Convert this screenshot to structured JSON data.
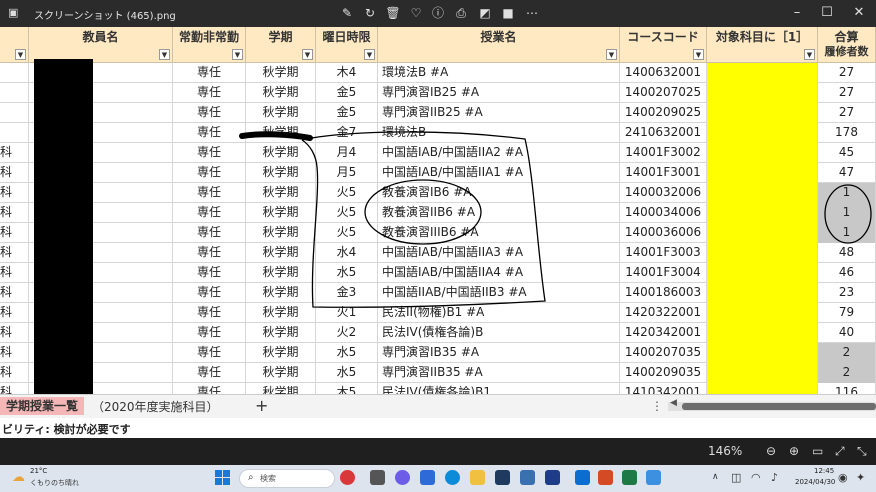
{
  "titlebar": {
    "filename": "スクリーンショット (465).png",
    "icons": [
      "image-icon",
      "edit-icon",
      "rotate-icon",
      "delete-icon",
      "favorite-icon",
      "info-icon",
      "print-icon",
      "remove-bg-icon",
      "clipchamp-icon",
      "more-icon"
    ],
    "window_buttons": [
      "minimize",
      "maximize",
      "close"
    ]
  },
  "sheet": {
    "headers": [
      {
        "label": ""
      },
      {
        "label": "教員名"
      },
      {
        "label": "常勤非常勤"
      },
      {
        "label": "学期"
      },
      {
        "label": "曜日時限"
      },
      {
        "label": "授業名"
      },
      {
        "label": "コースコード"
      },
      {
        "label": "対象科目に［1］"
      },
      {
        "label": "合算",
        "sub": "履修者数"
      }
    ],
    "rows": [
      {
        "a": "",
        "status": "専任",
        "term": "秋学期",
        "day": "木4",
        "course": "環境法B #A",
        "code": "1400632001",
        "count": "27",
        "grey": false
      },
      {
        "a": "",
        "status": "専任",
        "term": "秋学期",
        "day": "金5",
        "course": "専門演習IB25 #A",
        "code": "1400207025",
        "count": "27",
        "grey": false
      },
      {
        "a": "",
        "status": "専任",
        "term": "秋学期",
        "day": "金5",
        "course": "専門演習IIB25 #A",
        "code": "1400209025",
        "count": "27",
        "grey": false
      },
      {
        "a": "",
        "status": "専任",
        "term": "秋学期",
        "day": "金7",
        "course": "環境法B",
        "code": "2410632001",
        "count": "178",
        "grey": false
      },
      {
        "a": "科",
        "status": "専任",
        "term": "秋学期",
        "day": "月4",
        "course": "中国語IAB/中国語IIA2 #A",
        "code": "14001F3002",
        "count": "45",
        "grey": false
      },
      {
        "a": "科",
        "status": "専任",
        "term": "秋学期",
        "day": "月5",
        "course": "中国語IAB/中国語IIA1 #A",
        "code": "14001F3001",
        "count": "47",
        "grey": false
      },
      {
        "a": "科",
        "status": "専任",
        "term": "秋学期",
        "day": "火5",
        "course": "教養演習IB6 #A",
        "code": "1400032006",
        "count": "1",
        "grey": true
      },
      {
        "a": "科",
        "status": "専任",
        "term": "秋学期",
        "day": "火5",
        "course": "教養演習IIB6 #A",
        "code": "1400034006",
        "count": "1",
        "grey": true
      },
      {
        "a": "科",
        "status": "専任",
        "term": "秋学期",
        "day": "火5",
        "course": "教養演習IIIB6 #A",
        "code": "1400036006",
        "count": "1",
        "grey": true
      },
      {
        "a": "科",
        "status": "専任",
        "term": "秋学期",
        "day": "水4",
        "course": "中国語IAB/中国語IIA3 #A",
        "code": "14001F3003",
        "count": "48",
        "grey": false
      },
      {
        "a": "科",
        "status": "専任",
        "term": "秋学期",
        "day": "水5",
        "course": "中国語IAB/中国語IIA4 #A",
        "code": "14001F3004",
        "count": "46",
        "grey": false
      },
      {
        "a": "科",
        "status": "専任",
        "term": "秋学期",
        "day": "金3",
        "course": "中国語IIAB/中国語IIB3 #A",
        "code": "1400186003",
        "count": "23",
        "grey": false
      },
      {
        "a": "科",
        "status": "専任",
        "term": "秋学期",
        "day": "火1",
        "course": "民法II(物権)B1 #A",
        "code": "1420322001",
        "count": "79",
        "grey": false
      },
      {
        "a": "科",
        "status": "専任",
        "term": "秋学期",
        "day": "火2",
        "course": "民法IV(債権各論)B",
        "code": "1420342001",
        "count": "40",
        "grey": false
      },
      {
        "a": "科",
        "status": "専任",
        "term": "秋学期",
        "day": "水5",
        "course": "専門演習IB35 #A",
        "code": "1400207035",
        "count": "2",
        "grey": true
      },
      {
        "a": "科",
        "status": "専任",
        "term": "秋学期",
        "day": "水5",
        "course": "専門演習IIB35 #A",
        "code": "1400209035",
        "count": "2",
        "grey": true
      },
      {
        "a": "科",
        "status": "専任",
        "term": "秋学期",
        "day": "木5",
        "course": "民法IV(債権各論)B1",
        "code": "1410342001",
        "count": "116",
        "grey": false
      }
    ]
  },
  "tabs": {
    "active": "学期授業一覧",
    "second": "（2020年度実施科目）",
    "add": "+",
    "menu": "⋮"
  },
  "accessibility": "ビリティ: 検討が必要です",
  "viewbar": {
    "zoom": "146%"
  },
  "taskbar": {
    "temp": "21°C",
    "weather": "くもりのち晴れ",
    "search": "検索",
    "time": "12:45",
    "date": "2024/04/30"
  },
  "colors": {
    "header_bg": "#ffe9c2",
    "yellow": "#ffff00",
    "grey": "#c8c8c8",
    "active_tab": "#f4b6b6"
  }
}
